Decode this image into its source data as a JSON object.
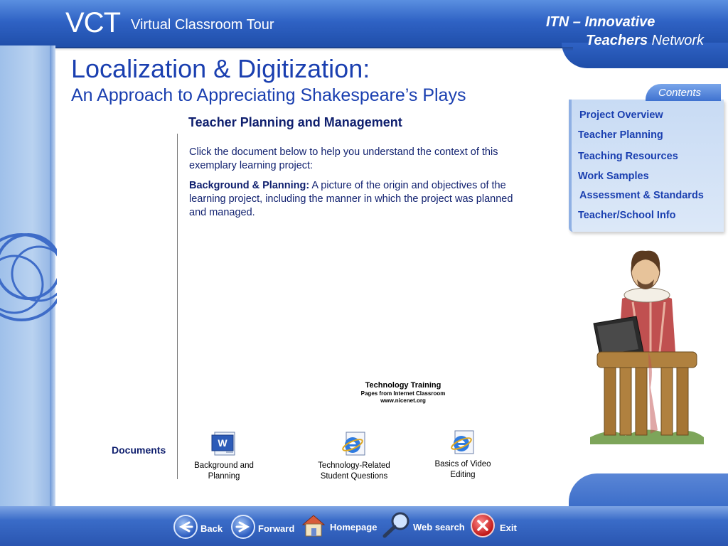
{
  "header": {
    "logo": "VCT",
    "subtitle": "Virtual Classroom Tour",
    "network_line1": "ITN – Innovative",
    "network_line2_bold": "Teachers",
    "network_line2_rest": "Network"
  },
  "page": {
    "title": "Localization & Digitization:",
    "subtitle": "An Approach to Appreciating Shakespeare’s Plays",
    "section_heading": "Teacher Planning and Management"
  },
  "intro": {
    "paragraph1": "Click the document below to help you understand the context of this exemplary learning project:",
    "bold_label": "Background & Planning:",
    "paragraph2": " A picture of the origin and objectives of the learning project, including the manner in which the project was planned and managed."
  },
  "tech_training": {
    "title": "Technology Training",
    "line1": "Pages from Internet Classroom",
    "line2": "www.nicenet.org"
  },
  "documents": {
    "label": "Documents",
    "items": [
      {
        "label": "Background and Planning",
        "icon": "word-document-icon"
      },
      {
        "label": "Technology-Related Student Questions",
        "icon": "internet-explorer-icon"
      },
      {
        "label": "Basics of Video Editing",
        "icon": "internet-explorer-icon"
      }
    ]
  },
  "contents": {
    "label": "Contents",
    "items": [
      "Project Overview",
      "Teacher Planning",
      "Teaching Resources",
      "Work Samples",
      "Assessment & Standards",
      "Teacher/School Info"
    ]
  },
  "bottom_nav": {
    "back": "Back",
    "forward": "Forward",
    "homepage": "Homepage",
    "web_search": "Web search",
    "exit": "Exit"
  },
  "colors": {
    "header_blue": "#2f62c4",
    "title_blue": "#1a3fb0",
    "nav_blue": "#1a3fb0"
  }
}
